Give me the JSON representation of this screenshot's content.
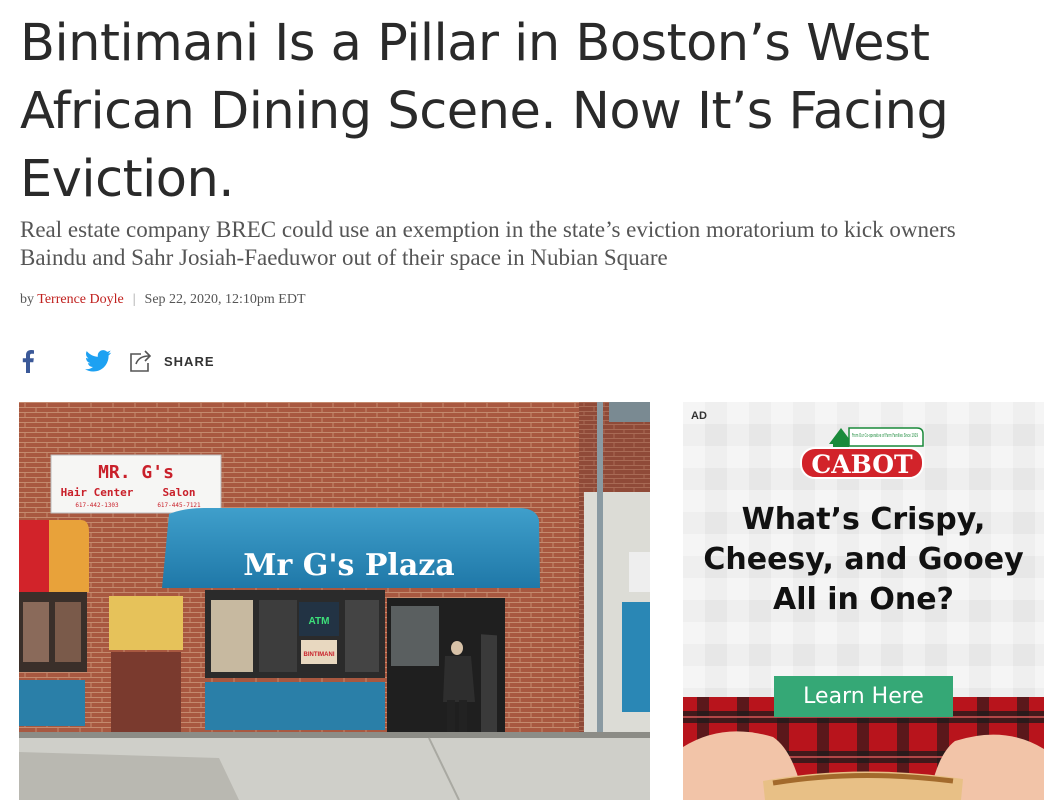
{
  "article": {
    "headline": "Bintimani Is a Pillar in Boston’s West African Dining Scene. Now It’s Facing Eviction.",
    "dek": "Real estate company BREC could use an exemption in the state’s eviction moratorium to kick owners Baindu and Sahr Josiah-Faeduwor out of their space in Nubian Square",
    "byline": {
      "prefix": "by",
      "author": "Terrence Doyle",
      "separator": "|",
      "date": "Sep 22, 2020, 12:10pm EDT"
    }
  },
  "share": {
    "facebook_icon": "facebook-icon",
    "twitter_icon": "twitter-icon",
    "share_icon": "share-icon",
    "share_label": "SHARE"
  },
  "photo": {
    "salon_sign": {
      "line1": "MR. G's",
      "left_text": "Hair Center",
      "right_text": "Salon",
      "left_phone": "617-442-1303",
      "right_phone": "617-445-7121"
    },
    "awning_text": "Mr G's Plaza",
    "atm_sign": "ATM",
    "window_sign": "BINTIMANI"
  },
  "ad": {
    "label": "AD",
    "brand": "CABOT",
    "brand_tagline": "From Our Co-operative of Farm Families Since 1919",
    "headline": "What’s Crispy, Cheesy, and Gooey All in One?",
    "cta": "Learn Here",
    "colors": {
      "brand_red": "#d2232a",
      "cta_green": "#35a876",
      "flannel": "#b8141c"
    }
  }
}
